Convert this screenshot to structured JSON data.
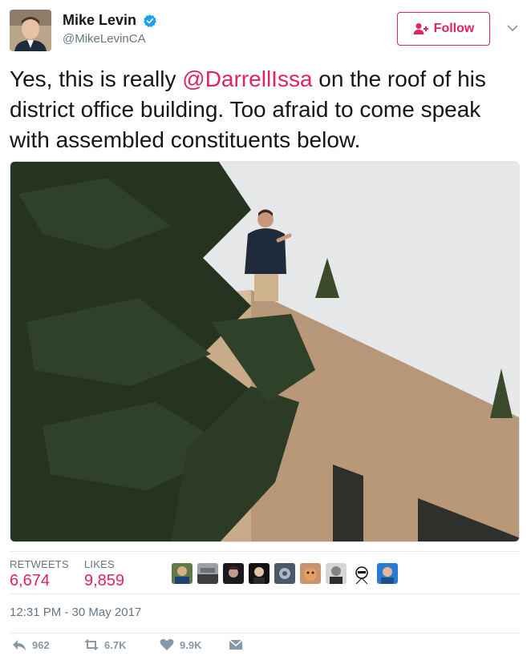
{
  "user": {
    "display_name": "Mike Levin",
    "handle": "@MikeLevinCA",
    "verified_icon": "verified-badge-icon"
  },
  "follow_button": {
    "label": "Follow",
    "icon": "add-user-icon"
  },
  "menu": {
    "icon": "chevron-down-icon"
  },
  "tweet": {
    "text_before": "Yes, this is really ",
    "mention": "@DarrellIssa",
    "text_after": " on the roof of his district office building.  Too afraid to come speak with assembled constituents below."
  },
  "stats": {
    "retweets_label": "RETWEETS",
    "retweets_value": "6,674",
    "likes_label": "LIKES",
    "likes_value": "9,859"
  },
  "timestamp": "12:31 PM - 30 May 2017",
  "actions": {
    "reply_count": "962",
    "retweet_count": "6.7K",
    "like_count": "9.9K"
  },
  "colors": {
    "accent": "#e0245e",
    "muted": "#657786",
    "verified": "#1da1f2"
  }
}
